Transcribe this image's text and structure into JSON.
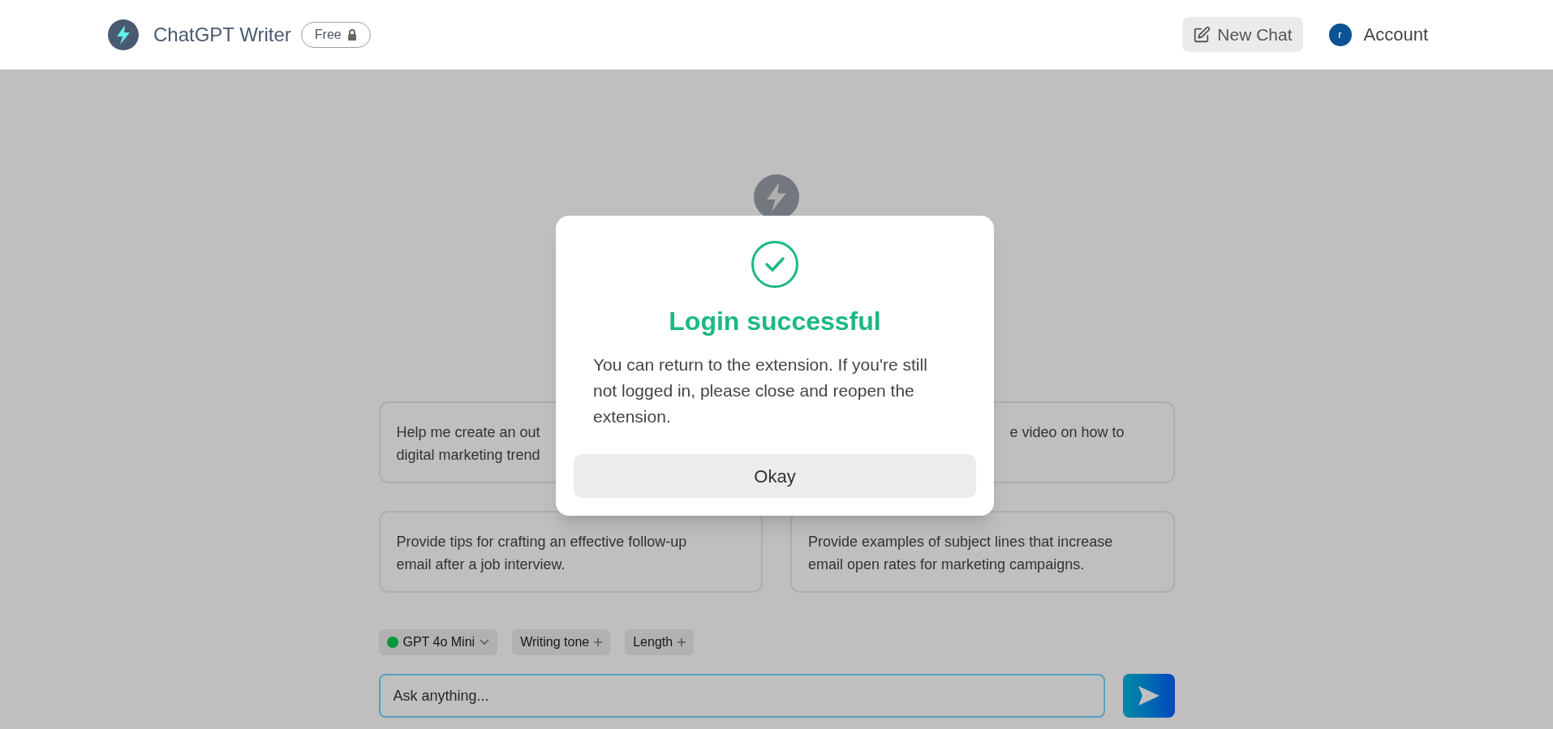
{
  "header": {
    "title": "ChatGPT Writer",
    "badge": "Free",
    "new_chat": "New Chat",
    "account": {
      "avatar": "r",
      "label": "Account"
    }
  },
  "background": {
    "prompt_cards": [
      {
        "lines": [
          "Help me create an out",
          "digital marketing trend"
        ],
        "kind": "plain"
      },
      {
        "lines": [
          "e video on how to"
        ],
        "kind": "covered"
      },
      {
        "lines": [
          "Provide tips for crafting an effective follow-up",
          "email after a job interview."
        ],
        "kind": "plain"
      },
      {
        "lines": [
          "Provide examples of subject lines that increase",
          "email open rates for marketing campaigns."
        ],
        "kind": "plain"
      }
    ],
    "chips": [
      {
        "label": "GPT 4o Mini",
        "kind": "model"
      },
      {
        "label": "Writing tone",
        "kind": "add"
      },
      {
        "label": "Length",
        "kind": "add"
      }
    ],
    "input": {
      "placeholder": "Ask anything..."
    }
  },
  "dialog": {
    "title": "Login successful",
    "message": "You can return to the extension. If you're still not logged in, please close and reopen the extension.",
    "button": "Okay"
  }
}
